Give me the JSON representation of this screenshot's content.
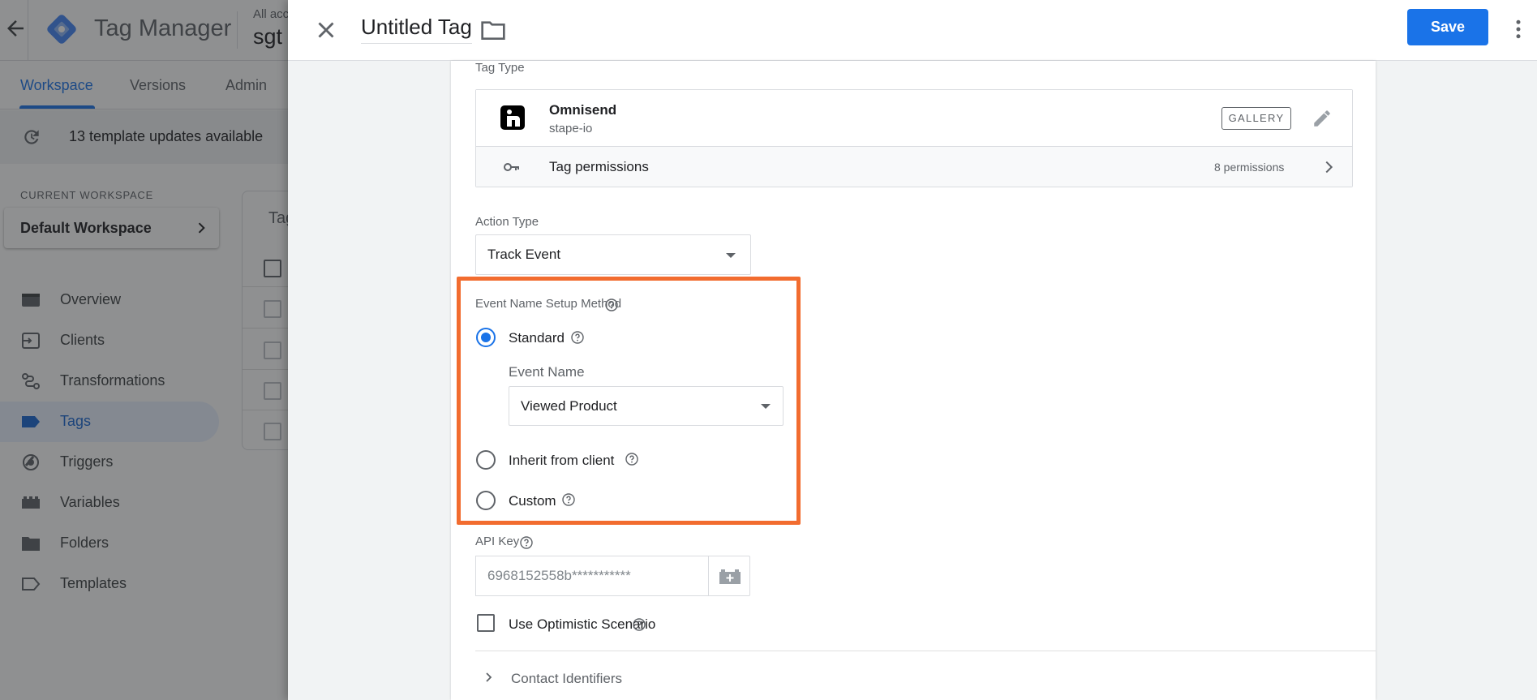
{
  "app": {
    "title": "Tag Manager",
    "account_label": "All acc",
    "account_name": "sgt",
    "tabs": [
      {
        "label": "Workspace"
      },
      {
        "label": "Versions"
      },
      {
        "label": "Admin"
      }
    ],
    "updates_text": "13 template updates available",
    "current_workspace_label": "CURRENT WORKSPACE",
    "workspace_name": "Default Workspace",
    "nav": [
      {
        "label": "Overview",
        "icon": "overview-icon"
      },
      {
        "label": "Clients",
        "icon": "clients-icon"
      },
      {
        "label": "Transformations",
        "icon": "transformations-icon"
      },
      {
        "label": "Tags",
        "icon": "tag-icon"
      },
      {
        "label": "Triggers",
        "icon": "trigger-icon"
      },
      {
        "label": "Variables",
        "icon": "variables-icon"
      },
      {
        "label": "Folders",
        "icon": "folder-icon"
      },
      {
        "label": "Templates",
        "icon": "template-icon"
      }
    ],
    "card_title": "Tag"
  },
  "panel": {
    "title": "Untitled Tag",
    "save_label": "Save",
    "tag_type_label": "Tag Type",
    "tag_name": "Omnisend",
    "tag_author": "stape-io",
    "gallery_label": "GALLERY",
    "permissions_label": "Tag permissions",
    "permissions_count": "8 permissions",
    "action_type_label": "Action Type",
    "action_type_value": "Track Event",
    "event_setup_label": "Event Name Setup Method",
    "radio_standard": "Standard",
    "event_name_label": "Event Name",
    "event_name_value": "Viewed Product",
    "radio_inherit": "Inherit from client",
    "radio_custom": "Custom",
    "api_key_label": "API Key",
    "api_key_value": "6968152558b***********",
    "optimistic_label": "Use Optimistic Scenario",
    "contact_identifiers_label": "Contact Identifiers"
  },
  "colors": {
    "accent": "#1a73e8",
    "highlight": "#f26c2f"
  }
}
